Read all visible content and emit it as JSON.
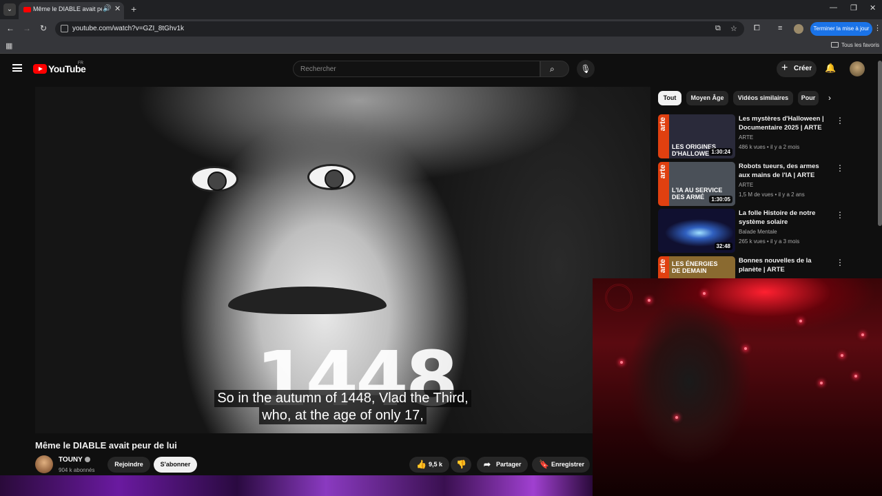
{
  "browser": {
    "tab_title": "Même le DIABLE avait peur de lui",
    "url": "youtube.com/watch?v=GZI_8tGhv1k",
    "update_label": "Terminer la mise à jour",
    "bookmarks_all": "Tous les favoris"
  },
  "youtube": {
    "logo_text": "YouTube",
    "country": "FR",
    "search_placeholder": "Rechercher",
    "create_label": "Créer"
  },
  "video": {
    "overlay_year": "1448",
    "subtitle_line1": "So in the autumn of 1448, Vlad the Third,",
    "subtitle_line2": "who, at the age of only 17,",
    "title": "Même le DIABLE avait peur de lui",
    "channel": "TOUNY",
    "subscribers": "904 k abonnés",
    "join_label": "Rejoindre",
    "subscribe_label": "S'abonner",
    "likes": "9,5 k",
    "share_label": "Partager",
    "save_label": "Enregistrer"
  },
  "chips": [
    "Tout",
    "Moyen Âge",
    "Vidéos similaires",
    "Pour"
  ],
  "recommendations": [
    {
      "title": "Les mystères d'Halloween | Documentaire 2025 | ARTE",
      "channel": "ARTE",
      "views": "486 k vues",
      "age": "il y a 2 mois",
      "duration": "1:30:24",
      "thumb_text": "LES ORIGINES D'HALLOWE"
    },
    {
      "title": "Robots tueurs, des armes aux mains de l'IA | ARTE",
      "channel": "ARTE",
      "views": "1,5 M de vues",
      "age": "il y a 2 ans",
      "duration": "1:30:05",
      "thumb_text": "L'IA AU SERVICE DES ARMÉ"
    },
    {
      "title": "La folle Histoire de notre système solaire",
      "channel": "Balade Mentale",
      "views": "265 k vues",
      "age": "il y a 3 mois",
      "duration": "32:48",
      "thumb_text": ""
    },
    {
      "title": "Bonnes nouvelles de la planète | ARTE",
      "channel": "ARTE",
      "views": "",
      "age": "",
      "duration": "",
      "thumb_text": "LES ÉNERGIES DE DEMAIN"
    }
  ],
  "icons": {
    "arte_logo": "arte"
  },
  "colors": {
    "yt_red": "#ff0000",
    "update_blue": "#1a73e8",
    "background": "#0f0f0f"
  }
}
